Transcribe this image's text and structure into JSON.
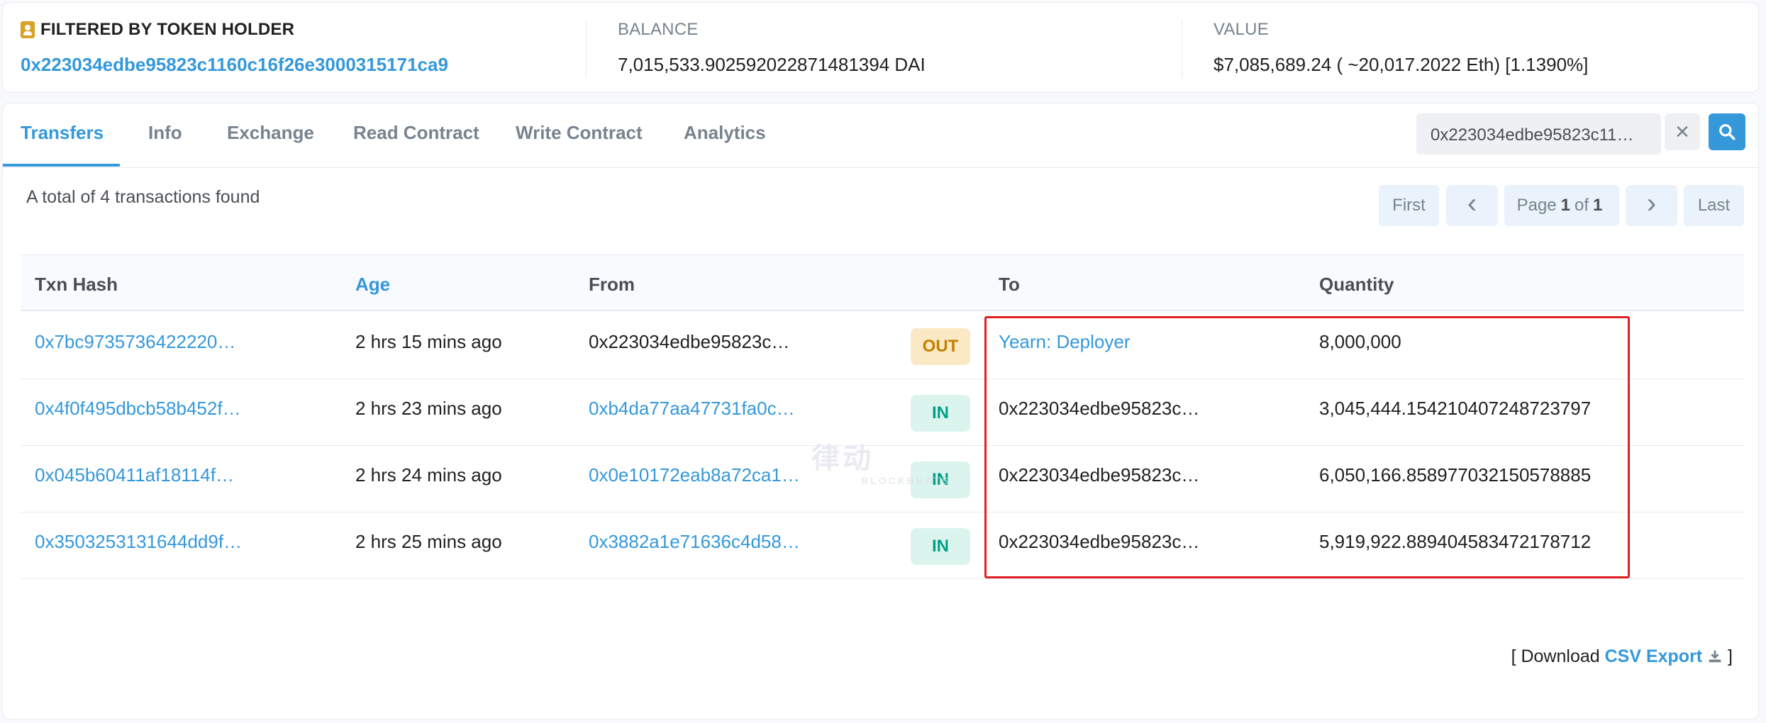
{
  "summary": {
    "holder_label": "FILTERED BY TOKEN HOLDER",
    "holder_address": "0x223034edbe95823c1160c16f26e3000315171ca9",
    "balance_label": "BALANCE",
    "balance_value": "7,015,533.902592022871481394 DAI",
    "value_label": "VALUE",
    "value_value": "$7,085,689.24 ( ~20,017.2022 Eth) [1.1390%]"
  },
  "tabs": [
    "Transfers",
    "Info",
    "Exchange",
    "Read Contract",
    "Write Contract",
    "Analytics"
  ],
  "active_tab": "Transfers",
  "search": {
    "value": "0x223034edbe95823c11…",
    "clear_glyph": "✕"
  },
  "total_text": "A total of 4 transactions found",
  "pager": {
    "first": "First",
    "prev": "‹",
    "page_prefix": "Page",
    "page_current": "1",
    "page_of": "of",
    "page_total": "1",
    "next": "›",
    "last": "Last"
  },
  "table": {
    "headers": {
      "txn_hash": "Txn Hash",
      "age": "Age",
      "from": "From",
      "to": "To",
      "quantity": "Quantity"
    },
    "rows": [
      {
        "hash": "0x7bc9735736422220…",
        "age": "2 hrs 15 mins ago",
        "from": "0x223034edbe95823c…",
        "from_link": false,
        "direction": "OUT",
        "to": "Yearn: Deployer",
        "to_link": true,
        "quantity": "8,000,000"
      },
      {
        "hash": "0x4f0f495dbcb58b452f…",
        "age": "2 hrs 23 mins ago",
        "from": "0xb4da77aa47731fa0c…",
        "from_link": true,
        "direction": "IN",
        "to": "0x223034edbe95823c…",
        "to_link": false,
        "quantity": "3,045,444.154210407248723797"
      },
      {
        "hash": "0x045b60411af18114f…",
        "age": "2 hrs 24 mins ago",
        "from": "0x0e10172eab8a72ca1…",
        "from_link": true,
        "direction": "IN",
        "to": "0x223034edbe95823c…",
        "to_link": false,
        "quantity": "6,050,166.858977032150578885"
      },
      {
        "hash": "0x3503253131644dd9f…",
        "age": "2 hrs 25 mins ago",
        "from": "0x3882a1e71636c4d58…",
        "from_link": true,
        "direction": "IN",
        "to": "0x223034edbe95823c…",
        "to_link": false,
        "quantity": "5,919,922.889404583472178712"
      }
    ]
  },
  "csv": {
    "prefix": "[ Download",
    "link": "CSV Export",
    "suffix": "]"
  },
  "watermark": {
    "main": "律动",
    "sub": "BLOCKBEATS"
  },
  "colors": {
    "accent": "#3498db",
    "out_badge": "#fbe8c4",
    "in_badge": "#dcf4ee",
    "highlight": "#e02020"
  }
}
